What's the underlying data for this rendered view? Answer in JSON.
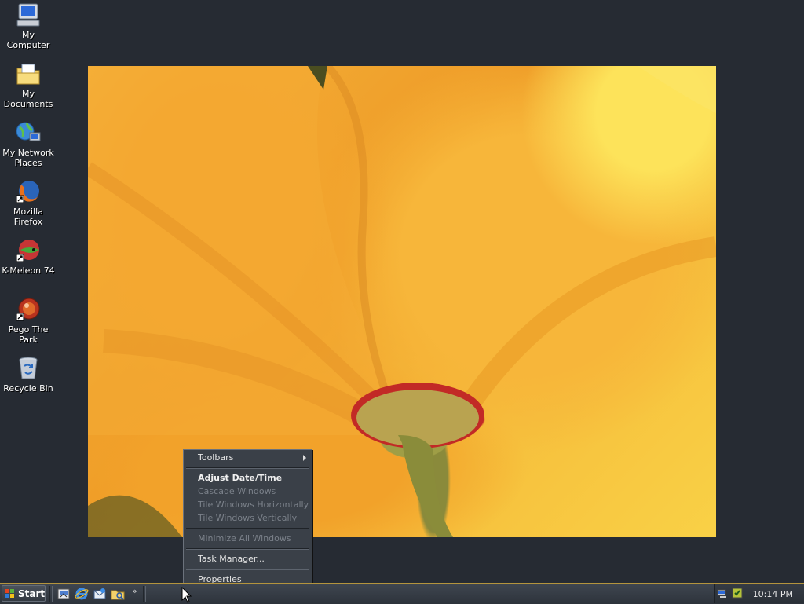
{
  "desktop": {
    "icons": [
      {
        "label": "My Computer",
        "icon": "my-computer-icon"
      },
      {
        "label": "My Documents",
        "icon": "my-documents-icon"
      },
      {
        "label": "My Network Places",
        "icon": "my-network-places-icon"
      },
      {
        "label": "Mozilla Firefox",
        "icon": "firefox-icon"
      },
      {
        "label": "K-Meleon 74",
        "icon": "k-meleon-icon"
      },
      {
        "label": "Pego The Park",
        "icon": "pego-icon"
      },
      {
        "label": "Recycle Bin",
        "icon": "recycle-bin-icon"
      }
    ]
  },
  "context_menu": {
    "items": [
      {
        "label": "Toolbars",
        "state": "enabled",
        "submenu": true
      },
      {
        "label": "Adjust Date/Time",
        "state": "default"
      },
      {
        "label": "Cascade Windows",
        "state": "disabled"
      },
      {
        "label": "Tile Windows Horizontally",
        "state": "disabled"
      },
      {
        "label": "Tile Windows Vertically",
        "state": "disabled"
      },
      {
        "label": "Minimize All Windows",
        "state": "disabled"
      },
      {
        "label": "Task Manager...",
        "state": "enabled"
      },
      {
        "label": "Properties",
        "state": "enabled"
      }
    ]
  },
  "taskbar": {
    "start_label": "Start",
    "quick_launch": [
      "show-desktop-icon",
      "internet-explorer-icon",
      "outlook-express-icon",
      "windows-explorer-icon"
    ],
    "overflow_label": "»",
    "clock": "10:14 PM"
  },
  "colors": {
    "desktop_bg": "#262b33",
    "taskbar_accent": "#b4943d",
    "menu_bg": "#3a4048"
  }
}
